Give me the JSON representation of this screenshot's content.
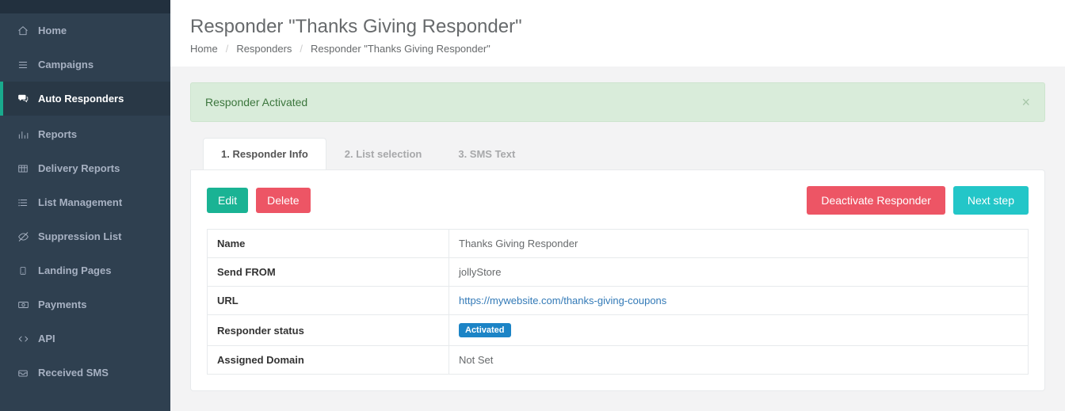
{
  "sidebar": {
    "items": [
      {
        "icon": "home-icon",
        "label": "Home"
      },
      {
        "icon": "bars-icon",
        "label": "Campaigns"
      },
      {
        "icon": "comments-icon",
        "label": "Auto Responders",
        "active": true
      },
      {
        "icon": "bar-chart-icon",
        "label": "Reports"
      },
      {
        "icon": "table-icon",
        "label": "Delivery Reports"
      },
      {
        "icon": "list-icon",
        "label": "List Management"
      },
      {
        "icon": "eye-slash-icon",
        "label": "Suppression List"
      },
      {
        "icon": "tablet-icon",
        "label": "Landing Pages"
      },
      {
        "icon": "money-icon",
        "label": "Payments"
      },
      {
        "icon": "code-icon",
        "label": "API"
      },
      {
        "icon": "inbox-icon",
        "label": "Received SMS"
      }
    ]
  },
  "header": {
    "title": "Responder \"Thanks Giving Responder\"",
    "breadcrumb": [
      "Home",
      "Responders",
      "Responder \"Thanks Giving Responder\""
    ]
  },
  "alert": {
    "text": "Responder Activated"
  },
  "tabs": [
    {
      "label": "1. Responder Info",
      "active": true
    },
    {
      "label": "2. List selection"
    },
    {
      "label": "3. SMS Text"
    }
  ],
  "actions": {
    "edit": "Edit",
    "delete": "Delete",
    "deactivate": "Deactivate Responder",
    "next": "Next step"
  },
  "details": {
    "rows": [
      {
        "key": "Name",
        "value": "Thanks Giving Responder"
      },
      {
        "key": "Send FROM",
        "value": "jollyStore"
      },
      {
        "key": "URL",
        "value": "https://mywebsite.com/thanks-giving-coupons",
        "link": true
      },
      {
        "key": "Responder status",
        "value": "Activated",
        "badge": true
      },
      {
        "key": "Assigned Domain",
        "value": "Not Set"
      }
    ]
  },
  "colors": {
    "primary_teal": "#1ab394",
    "red": "#ed5565",
    "teal": "#23c6c8",
    "blue": "#1c84c6"
  }
}
